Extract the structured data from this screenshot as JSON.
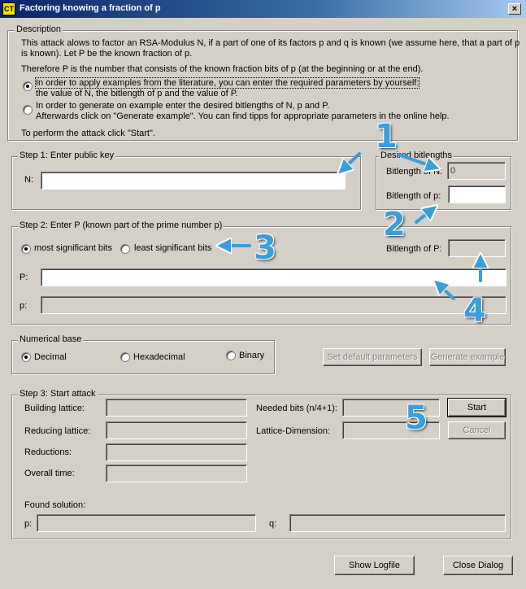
{
  "window": {
    "title": "Factoring knowing a fraction of p",
    "icon_label": "CT",
    "close_glyph": "×"
  },
  "description": {
    "legend": "Description",
    "line1": "This attack alows to factor an RSA-Modulus N, if a part of one of its factors p and q is known (we assume here, that a part of p",
    "line2": "is known). Let P be the known fraction of p.",
    "line3": "Therefore P is the number that consists of the known fraction bits of p (at the beginning or at the end).",
    "option1_line1": "In order to apply examples from the literature, you can enter the required parameters by yourself:",
    "option1_line2": "the value of N, the bitlength of p and the value of P.",
    "option2_line1": "In order to generate on example enter the desired bitlengths of N, p and P.",
    "option2_line2": "Afterwards click on \"Generate example\".  You can find tipps for appropriate parameters in the online help.",
    "footer": "To perform the attack click \"Start\"."
  },
  "step1": {
    "legend": "Step 1: Enter public key",
    "n_label": "N:",
    "n_value": ""
  },
  "bitlengths": {
    "legend": "Desired bitlengths",
    "n_label": "Bitlength of N:",
    "n_value": "0",
    "p_label": "Bitlength of p:",
    "p_value": ""
  },
  "step2": {
    "legend": "Step 2: Enter P (known part of the prime number p)",
    "msb_label": "most significant bits",
    "lsb_label": "least significant bits",
    "P_bitlength_label": "Bitlength of P:",
    "P_bitlength_value": "",
    "P_label": "P:",
    "P_value": "",
    "p_label": "p:",
    "p_value": ""
  },
  "numbase": {
    "legend": "Numerical base",
    "decimal": "Decimal",
    "hex": "Hexadecimal",
    "binary": "Binary"
  },
  "buttons": {
    "set_default": "Set default parameters",
    "generate": "Generate example",
    "start": "Start",
    "cancel": "Cancel",
    "show_logfile": "Show Logfile",
    "close_dialog": "Close Dialog"
  },
  "step3": {
    "legend": "Step 3: Start attack",
    "building_label": "Building lattice:",
    "reducing_label": "Reducing lattice:",
    "reductions_label": "Reductions:",
    "overall_label": "Overall time:",
    "needed_bits_label": "Needed bits (n/4+1):",
    "lattice_dim_label": "Lattice-Dimension:",
    "found_label": "Found solution:",
    "p_label": "p:",
    "q_label": "q:",
    "building_value": "",
    "reducing_value": "",
    "reductions_value": "",
    "overall_value": "",
    "needed_bits_value": "",
    "lattice_dim_value": "",
    "p_value": "",
    "q_value": ""
  },
  "annotations": {
    "n1": "1",
    "n2": "2",
    "n3": "3",
    "n4": "4",
    "n5": "5",
    "color": "#3a9fd8"
  }
}
